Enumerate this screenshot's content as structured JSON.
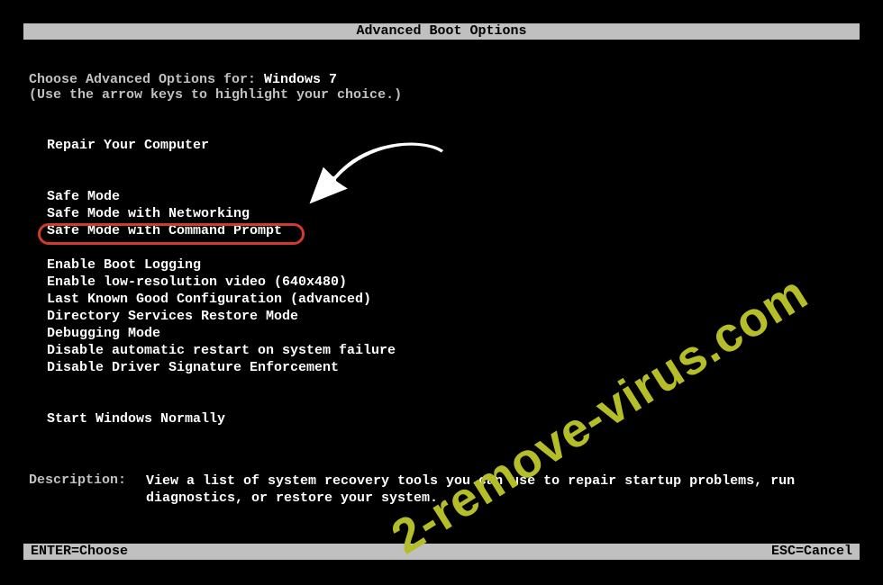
{
  "title": "Advanced Boot Options",
  "prompt_prefix": "Choose Advanced Options for: ",
  "os_name": "Windows 7",
  "hint": "(Use the arrow keys to highlight your choice.)",
  "menu": {
    "group1": [
      "Repair Your Computer"
    ],
    "group2": [
      "Safe Mode",
      "Safe Mode with Networking",
      "Safe Mode with Command Prompt"
    ],
    "group3": [
      "Enable Boot Logging",
      "Enable low-resolution video (640x480)",
      "Last Known Good Configuration (advanced)",
      "Directory Services Restore Mode",
      "Debugging Mode",
      "Disable automatic restart on system failure",
      "Disable Driver Signature Enforcement"
    ],
    "group4": [
      "Start Windows Normally"
    ]
  },
  "highlighted_item": "Safe Mode with Command Prompt",
  "description": {
    "label": "Description:",
    "text": "View a list of system recovery tools you can use to repair startup problems, run diagnostics, or restore your system."
  },
  "footer": {
    "left": "ENTER=Choose",
    "right": "ESC=Cancel"
  },
  "annotation": {
    "watermark": "2-remove-virus.com",
    "arrow_icon": "curved-arrow-icon"
  }
}
